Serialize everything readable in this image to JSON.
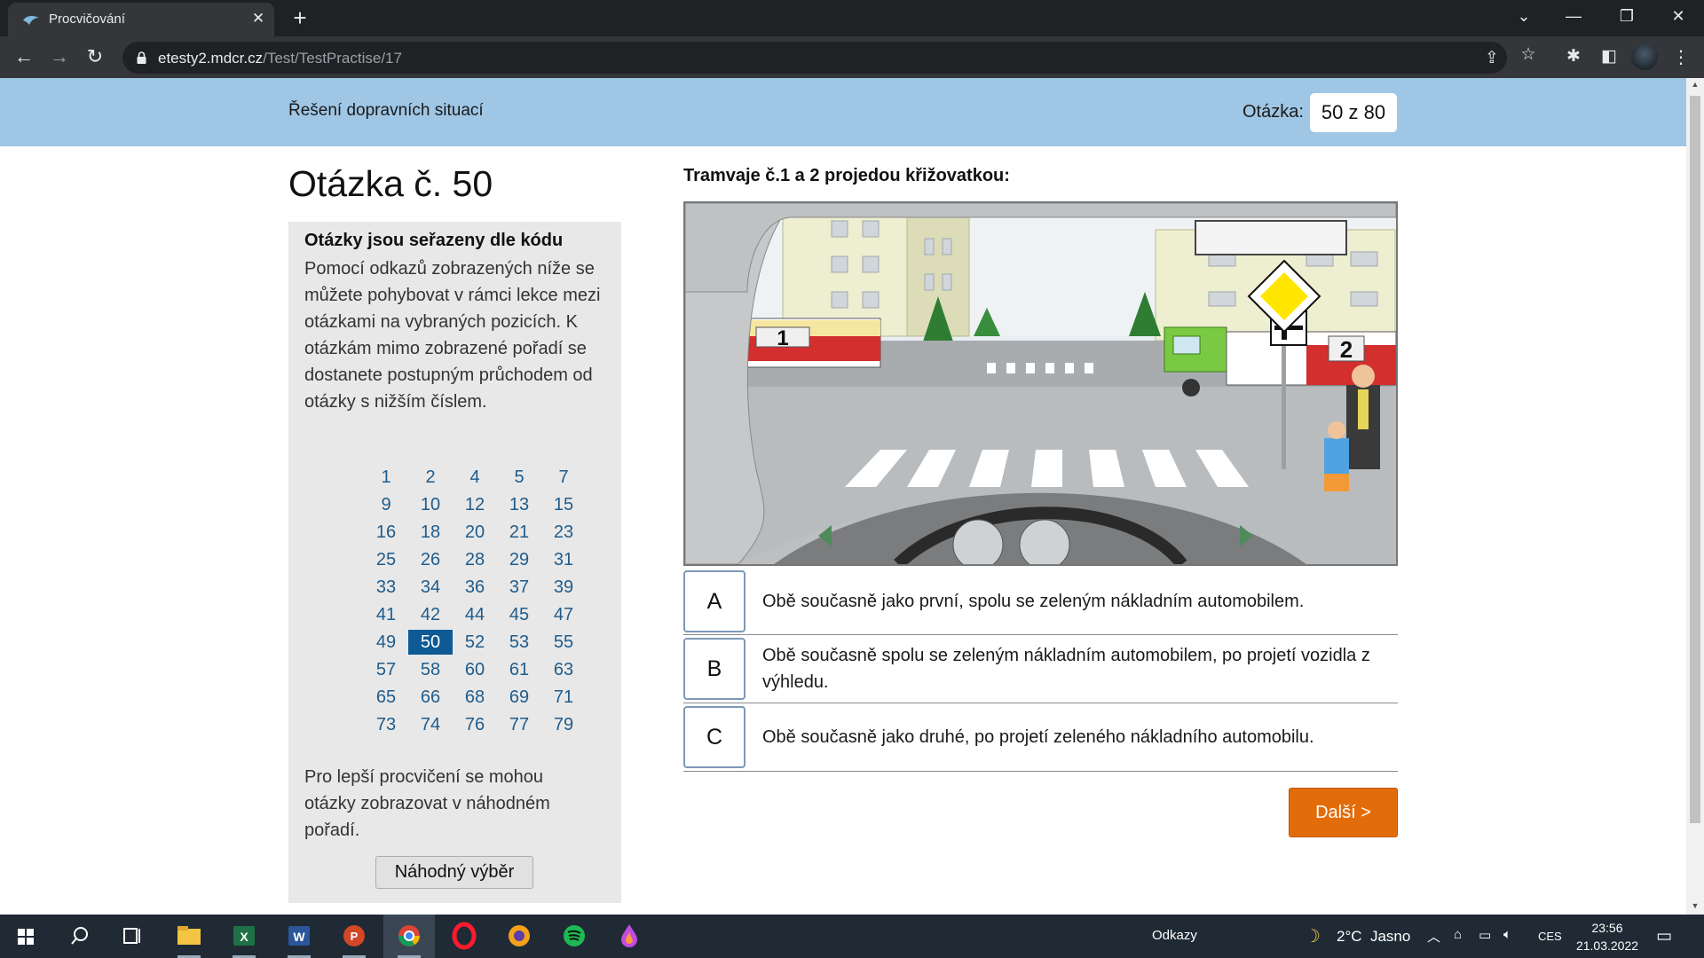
{
  "browser": {
    "tab_title": "Procvičování",
    "url_host": "etesty2.mdcr.cz",
    "url_path": "/Test/TestPractise/17"
  },
  "page": {
    "section_title": "Řešení dopravních situací",
    "question_label": "Otázka:",
    "question_counter": "50 z 80",
    "question_heading": "Otázka č. 50",
    "sidebar": {
      "title": "Otázky jsou seřazeny dle kódu",
      "description": "Pomocí odkazů zobrazených níže se můžete pohybovat v rámci lekce mezi otázkami na vybraných pozicích. K otázkám mimo zobrazené pořadí se dostanete postupným průchodem od otázky s nižším číslem.",
      "question_numbers": [
        [
          "1",
          "2",
          "4",
          "5",
          "7"
        ],
        [
          "9",
          "10",
          "12",
          "13",
          "15"
        ],
        [
          "16",
          "18",
          "20",
          "21",
          "23"
        ],
        [
          "25",
          "26",
          "28",
          "29",
          "31"
        ],
        [
          "33",
          "34",
          "36",
          "37",
          "39"
        ],
        [
          "41",
          "42",
          "44",
          "45",
          "47"
        ],
        [
          "49",
          "50",
          "52",
          "53",
          "55"
        ],
        [
          "57",
          "58",
          "60",
          "61",
          "63"
        ],
        [
          "65",
          "66",
          "68",
          "69",
          "71"
        ],
        [
          "73",
          "74",
          "76",
          "77",
          "79"
        ]
      ],
      "active_number": "50",
      "random_text": "Pro lepší procvičení se mohou otázky zobrazovat v náhodném pořadí.",
      "random_button": "Náhodný výběr"
    },
    "question_text": "Tramvaje č.1 a 2 projedou křižovatkou:",
    "scene_labels": {
      "tram1": "1",
      "tram2": "2"
    },
    "answers": [
      {
        "letter": "A",
        "text": "Obě současně jako první, spolu se zeleným nákladním automobilem."
      },
      {
        "letter": "B",
        "text": "Obě současně spolu se zeleným nákladním automobilem, po projetí vozidla z výhledu."
      },
      {
        "letter": "C",
        "text": "Obě současně jako druhé, po projetí zeleného nákladního automobilu."
      }
    ],
    "next_button": "Další >"
  },
  "taskbar": {
    "links_label": "Odkazy",
    "weather": "2°C  Jasno",
    "language": "CES",
    "time": "23:56",
    "date": "21.03.2022"
  },
  "colors": {
    "header_band": "#9fc6e5",
    "active_number": "#0d5a94",
    "link_number": "#1f5c8c",
    "next_button": "#e36c0a",
    "sidebar_bg": "#e8e8e8"
  }
}
